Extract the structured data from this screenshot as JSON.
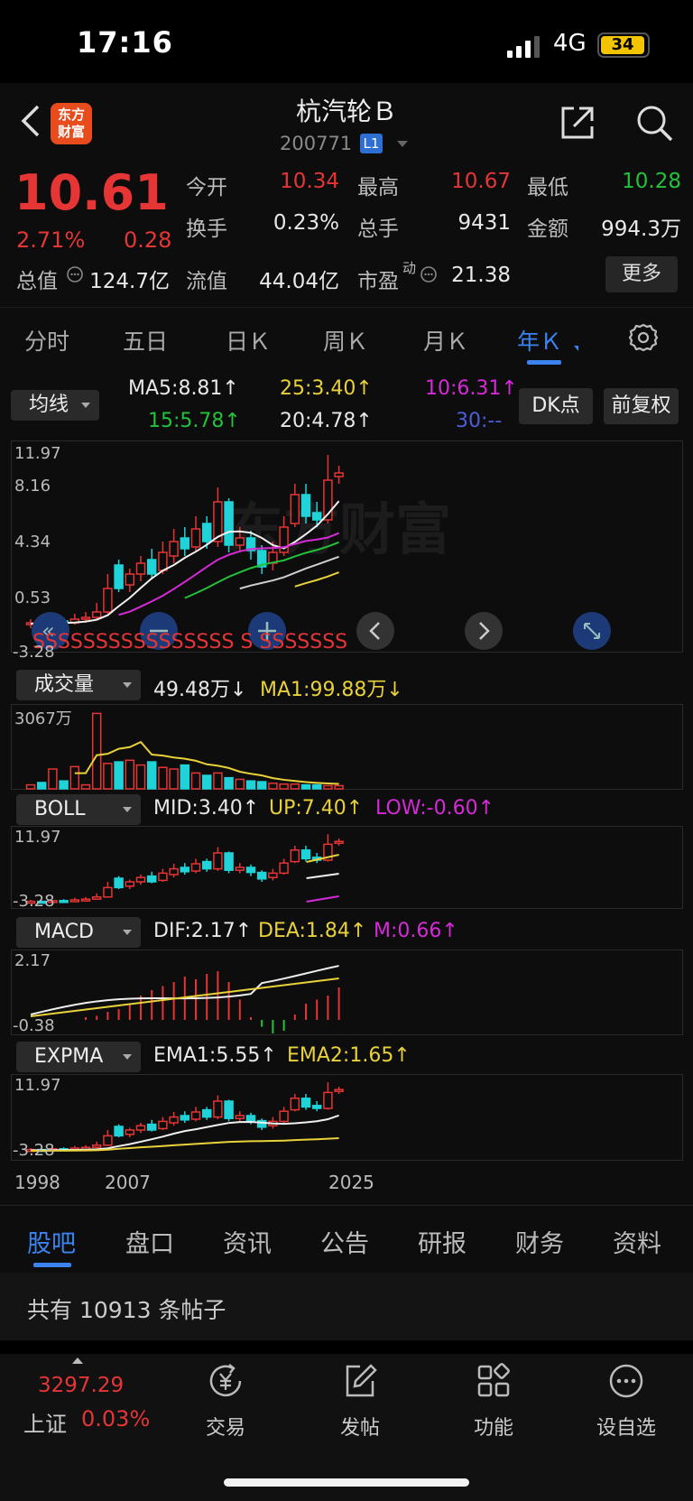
{
  "status_bar": {
    "time": "17:16",
    "network": "4G",
    "battery": "34"
  },
  "header": {
    "logo_line1": "东方",
    "logo_line2": "财富",
    "stock_name": "杭汽轮Ｂ",
    "stock_code": "200771",
    "level": "L1"
  },
  "quote": {
    "price": "10.61",
    "change_pct": "2.71%",
    "change": "0.28",
    "open_label": "今开",
    "open_value": "10.34",
    "high_label": "最高",
    "high_value": "10.67",
    "low_label": "最低",
    "low_value": "10.28",
    "turnover_label": "换手",
    "turnover_value": "0.23%",
    "volume_label": "总手",
    "volume_value": "9431",
    "amount_label": "金额",
    "amount_value": "994.3万",
    "mktcap_label": "总值",
    "mktcap_value": "124.7亿",
    "float_label": "流值",
    "float_value": "44.04亿",
    "pe_label": "市盈",
    "pe_sup": "动",
    "pe_value": "21.38",
    "more_label": "更多"
  },
  "kline_tabs": [
    "分时",
    "五日",
    "日Ｋ",
    "周Ｋ",
    "月Ｋ",
    "年Ｋ"
  ],
  "main_chart": {
    "indicator_button": "均线",
    "dk_button": "DK点",
    "adjust_button": "前复权",
    "ma5": "MA5:8.81↑",
    "ma10": "10:6.31↑",
    "ma15": "15:5.78↑",
    "ma20": "20:4.78↑",
    "ma25": "25:3.40↑",
    "ma30": "30:--",
    "y_ticks": [
      "11.97",
      "8.16",
      "4.34",
      "0.53",
      "-3.28"
    ],
    "signals": "SSSSSSSSSSSSSSSS  S  SSSSSSS",
    "watermark": "东方财富"
  },
  "volume_panel": {
    "indicator_button": "成交量",
    "vol": "49.48万↓",
    "ma1": "MA1:99.88万↓",
    "y_top": "3067万"
  },
  "boll_panel": {
    "indicator_button": "BOLL",
    "mid": "MID:3.40↑",
    "up": "UP:7.40↑",
    "low": "LOW:-0.60↑",
    "y_top": "11.97",
    "y_bottom": "-3.28"
  },
  "macd_panel": {
    "indicator_button": "MACD",
    "dif": "DIF:2.17↑",
    "dea": "DEA:1.84↑",
    "m": "M:0.66↑",
    "y_top": "2.17",
    "y_bottom": "-0.38"
  },
  "expma_panel": {
    "indicator_button": "EXPMA",
    "ema1": "EMA1:5.55↑",
    "ema2": "EMA2:1.65↑",
    "y_top": "11.97",
    "y_bottom": "-3.28"
  },
  "x_axis": [
    "1998",
    "2007",
    "2025"
  ],
  "bottom_tabs": [
    "股吧",
    "盘口",
    "资讯",
    "公告",
    "研报",
    "财务",
    "资料"
  ],
  "post_count": "共有 10913 条帖子",
  "bottom_nav": {
    "index_value": "3297.29",
    "index_name": "上证",
    "index_change": "0.03%",
    "trade": "交易",
    "post": "发帖",
    "functions": "功能",
    "watchlist": "设自选"
  },
  "colors": {
    "up": "#e63535",
    "down": "#1fd3d8",
    "accent": "#3a83f0",
    "yellow": "#e8d13a",
    "magenta": "#d62ad8"
  }
}
